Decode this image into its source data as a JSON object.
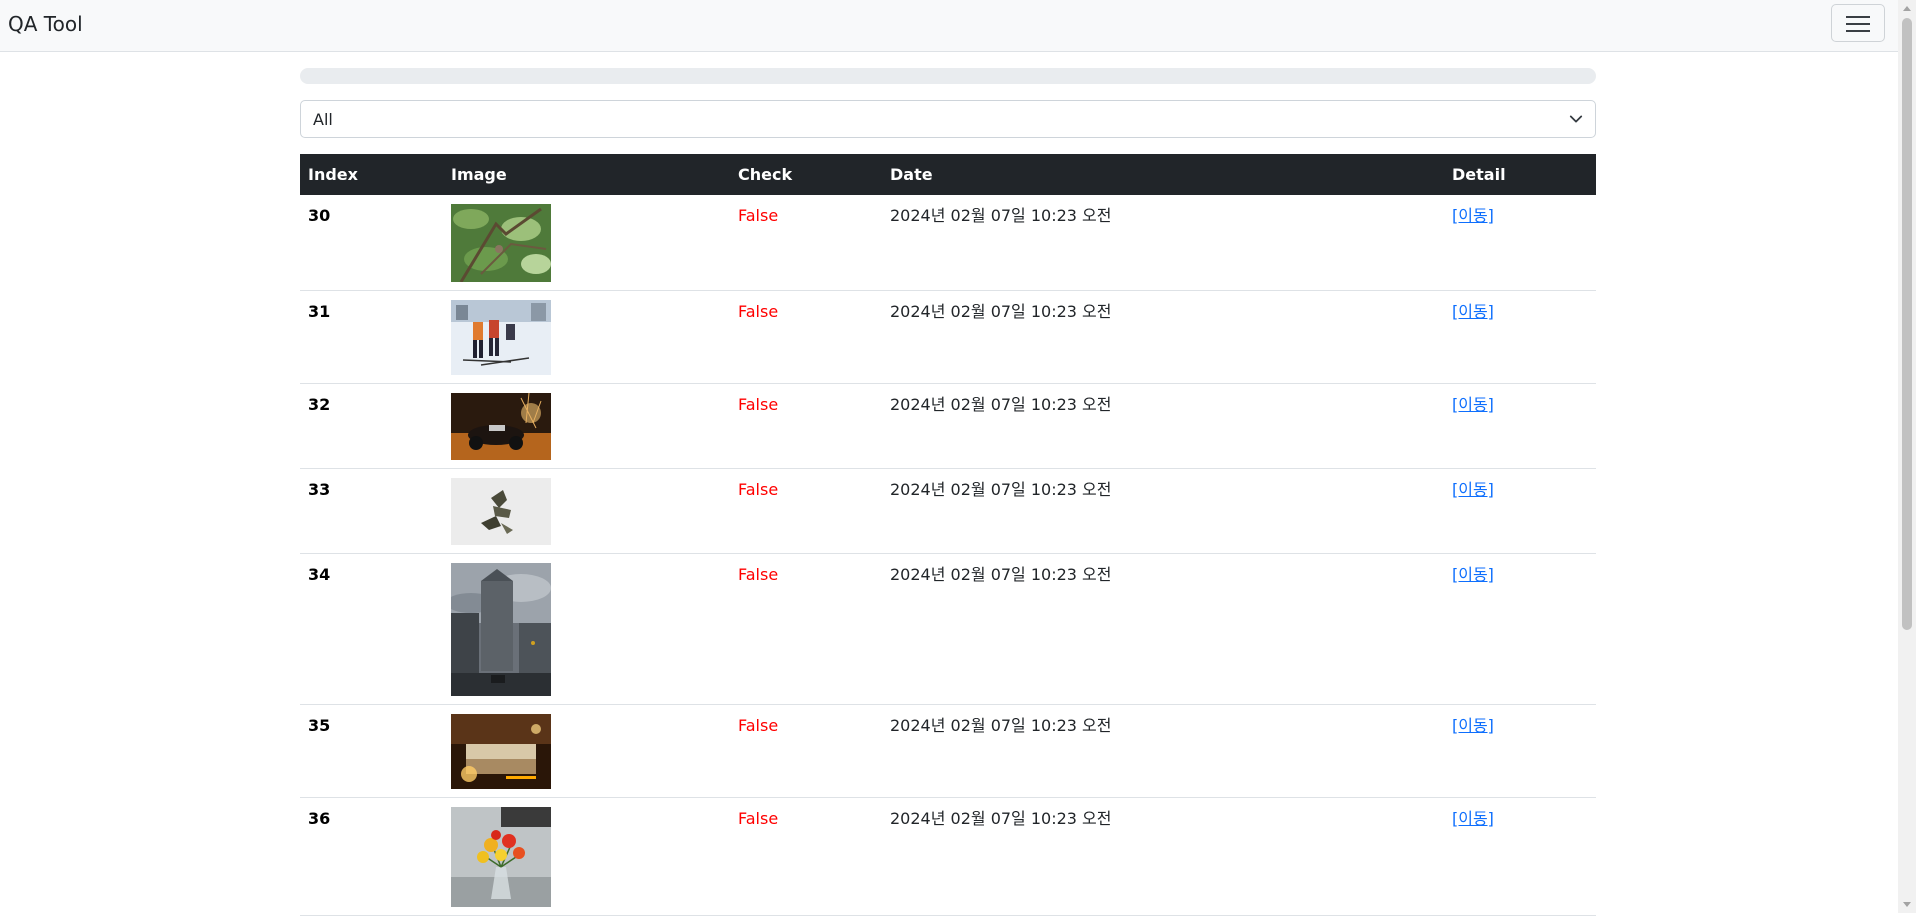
{
  "app": {
    "title": "QA Tool"
  },
  "progress": {
    "value_fraction": 0
  },
  "filter": {
    "selected": "All"
  },
  "table": {
    "headers": [
      "Index",
      "Image",
      "Check",
      "Date",
      "Detail"
    ],
    "rows": [
      {
        "index": "30",
        "check": "False",
        "date": "2024년 02월 07일 10:23 오전",
        "detail": "[이동]"
      },
      {
        "index": "31",
        "check": "False",
        "date": "2024년 02월 07일 10:23 오전",
        "detail": "[이동]"
      },
      {
        "index": "32",
        "check": "False",
        "date": "2024년 02월 07일 10:23 오전",
        "detail": "[이동]"
      },
      {
        "index": "33",
        "check": "False",
        "date": "2024년 02월 07일 10:23 오전",
        "detail": "[이동]"
      },
      {
        "index": "34",
        "check": "False",
        "date": "2024년 02월 07일 10:23 오전",
        "detail": "[이동]"
      },
      {
        "index": "35",
        "check": "False",
        "date": "2024년 02월 07일 10:23 오전",
        "detail": "[이동]"
      },
      {
        "index": "36",
        "check": "False",
        "date": "2024년 02월 07일 10:23 오전",
        "detail": "[이동]"
      }
    ]
  },
  "colors": {
    "header_bg": "#212529",
    "false_text": "#ff0000",
    "link": "#0d6efd",
    "navbar_bg": "#f8f9fa"
  },
  "icons": {
    "menu": "hamburger-menu-icon",
    "select_arrow": "chevron-down-icon"
  }
}
